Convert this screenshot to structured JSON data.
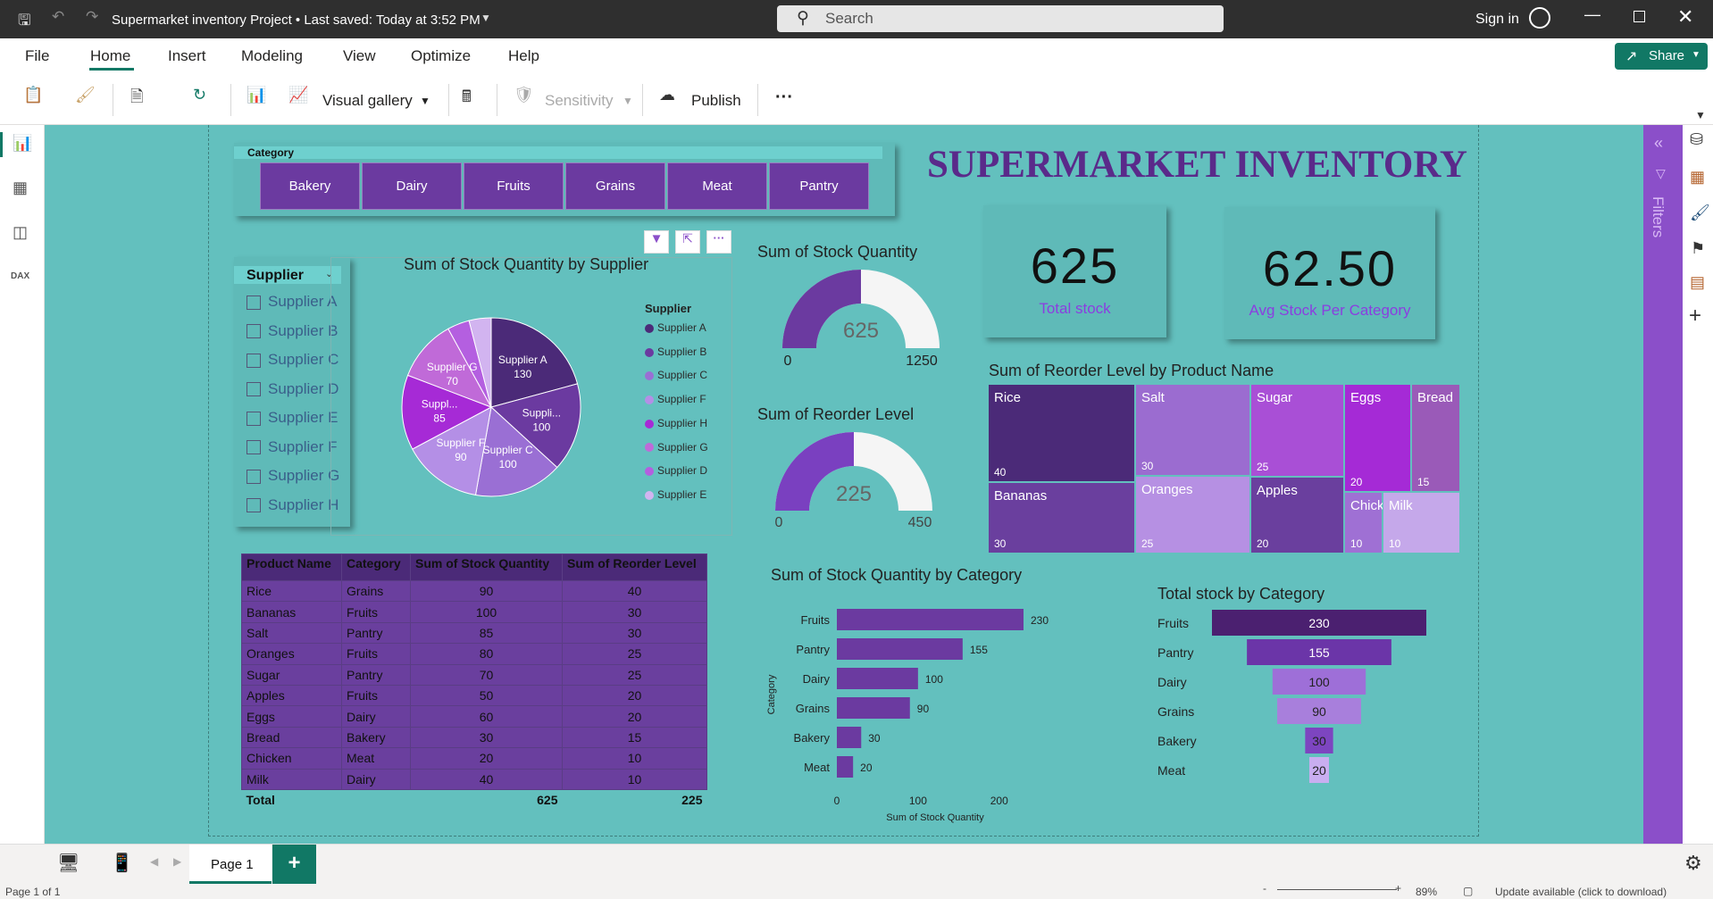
{
  "window": {
    "title": "Supermarket inventory Project • Last saved: Today at 3:52 PM",
    "search_placeholder": "Search",
    "sign_in": "Sign in"
  },
  "menu": {
    "items": [
      "File",
      "Home",
      "Insert",
      "Modeling",
      "View",
      "Optimize",
      "Help"
    ],
    "active": "Home",
    "share": "Share"
  },
  "ribbon": {
    "visual_gallery": "Visual gallery",
    "sensitivity": "Sensitivity",
    "publish": "Publish",
    "more": "···"
  },
  "report": {
    "title": "SUPERMARKET INVENTORY",
    "category_slicer": {
      "label": "Category",
      "items": [
        "Bakery",
        "Dairy",
        "Fruits",
        "Grains",
        "Meat",
        "Pantry"
      ]
    },
    "supplier_slicer": {
      "label": "Supplier",
      "items": [
        "Supplier A",
        "Supplier B",
        "Supplier C",
        "Supplier D",
        "Supplier E",
        "Supplier F",
        "Supplier G",
        "Supplier H"
      ]
    },
    "kpi_total": {
      "value": "625",
      "label": "Total stock"
    },
    "kpi_avg": {
      "value": "62.50",
      "label": "Avg Stock Per Category"
    },
    "gauge_stock": {
      "title": "Sum of Stock Quantity",
      "value": "625",
      "min": "0",
      "max": "1250"
    },
    "gauge_reorder": {
      "title": "Sum of Reorder Level",
      "value": "225",
      "min": "0",
      "max": "450"
    },
    "pie_title": "Sum of Stock Quantity by Supplier",
    "pie_legend_title": "Supplier",
    "treemap_title": "Sum of Reorder Level by Product Name",
    "bar_title": "Sum of Stock Quantity by Category",
    "funnel_title": "Total stock by Category",
    "table": {
      "headers": [
        "Product Name",
        "Category",
        "Sum of Stock Quantity",
        "Sum of Reorder Level"
      ],
      "rows": [
        [
          "Rice",
          "Grains",
          "90",
          "40"
        ],
        [
          "Bananas",
          "Fruits",
          "100",
          "30"
        ],
        [
          "Salt",
          "Pantry",
          "85",
          "30"
        ],
        [
          "Oranges",
          "Fruits",
          "80",
          "25"
        ],
        [
          "Sugar",
          "Pantry",
          "70",
          "25"
        ],
        [
          "Apples",
          "Fruits",
          "50",
          "20"
        ],
        [
          "Eggs",
          "Dairy",
          "60",
          "20"
        ],
        [
          "Bread",
          "Bakery",
          "30",
          "15"
        ],
        [
          "Chicken",
          "Meat",
          "20",
          "10"
        ],
        [
          "Milk",
          "Dairy",
          "40",
          "10"
        ]
      ],
      "total": [
        "Total",
        "",
        "625",
        "225"
      ]
    }
  },
  "chart_data": [
    {
      "type": "pie",
      "title": "Sum of Stock Quantity by Supplier",
      "legend_title": "Supplier",
      "legend": [
        "Supplier A",
        "Supplier B",
        "Supplier C",
        "Supplier F",
        "Supplier H",
        "Supplier G",
        "Supplier D",
        "Supplier E"
      ],
      "slices": [
        {
          "name": "Supplier A",
          "value": 130,
          "label": "Supplier A",
          "color": "#4b2a78"
        },
        {
          "name": "Supplier B",
          "value": 100,
          "label": "Suppli...",
          "color": "#6b3aa0"
        },
        {
          "name": "Supplier C",
          "value": 100,
          "label": "Supplier C",
          "color": "#9a6fd4"
        },
        {
          "name": "Supplier F",
          "value": 90,
          "label": "Supplier F",
          "color": "#b48fe6"
        },
        {
          "name": "Supplier H",
          "value": 85,
          "label": "Suppl...",
          "color": "#a62ad6"
        },
        {
          "name": "Supplier G",
          "value": 70,
          "label": "Supplier G",
          "color": "#c06ad8"
        },
        {
          "name": "Supplier D",
          "value": 25,
          "label": "",
          "color": "#b45fe0"
        },
        {
          "name": "Supplier E",
          "value": 25,
          "label": "",
          "color": "#d2b4f0"
        }
      ]
    },
    {
      "type": "bar",
      "orientation": "horizontal",
      "title": "Sum of Stock Quantity by Category",
      "xlabel": "Sum of Stock Quantity",
      "ylabel": "Category",
      "categories": [
        "Fruits",
        "Pantry",
        "Dairy",
        "Grains",
        "Bakery",
        "Meat"
      ],
      "values": [
        230,
        155,
        100,
        90,
        30,
        20
      ],
      "xlim": [
        0,
        250
      ],
      "xticks": [
        0,
        100,
        200
      ],
      "color": "#6b3aa0"
    },
    {
      "type": "bar",
      "subtype": "funnel",
      "title": "Total stock by Category",
      "categories": [
        "Fruits",
        "Pantry",
        "Dairy",
        "Grains",
        "Bakery",
        "Meat"
      ],
      "values": [
        230,
        155,
        100,
        90,
        30,
        20
      ],
      "colors": [
        "#4b2070",
        "#6b35a8",
        "#9e6fd8",
        "#a87fdc",
        "#7d45c0",
        "#c9aef0"
      ]
    },
    {
      "type": "heatmap",
      "subtype": "treemap",
      "title": "Sum of Reorder Level by Product Name",
      "items": [
        {
          "name": "Rice",
          "value": 40,
          "color": "#4b2a78"
        },
        {
          "name": "Bananas",
          "value": 30,
          "color": "#6a3f9e"
        },
        {
          "name": "Salt",
          "value": 30,
          "color": "#9b6cd0"
        },
        {
          "name": "Oranges",
          "value": 25,
          "color": "#b690e3"
        },
        {
          "name": "Sugar",
          "value": 25,
          "color": "#a94fd6"
        },
        {
          "name": "Apples",
          "value": 20,
          "color": "#6a3f9e"
        },
        {
          "name": "Eggs",
          "value": 20,
          "color": "#a52ad6"
        },
        {
          "name": "Bread",
          "value": 15,
          "color": "#9a5ab8"
        },
        {
          "name": "Chicken",
          "value": 10,
          "color": "#9f70d4"
        },
        {
          "name": "Milk",
          "value": 10,
          "color": "#c5a8ea"
        }
      ]
    }
  ],
  "bottom": {
    "page_tab": "Page 1",
    "add": "+",
    "status_left": "Page 1 of 1",
    "zoom": "89%",
    "update": "Update available (click to download)"
  }
}
